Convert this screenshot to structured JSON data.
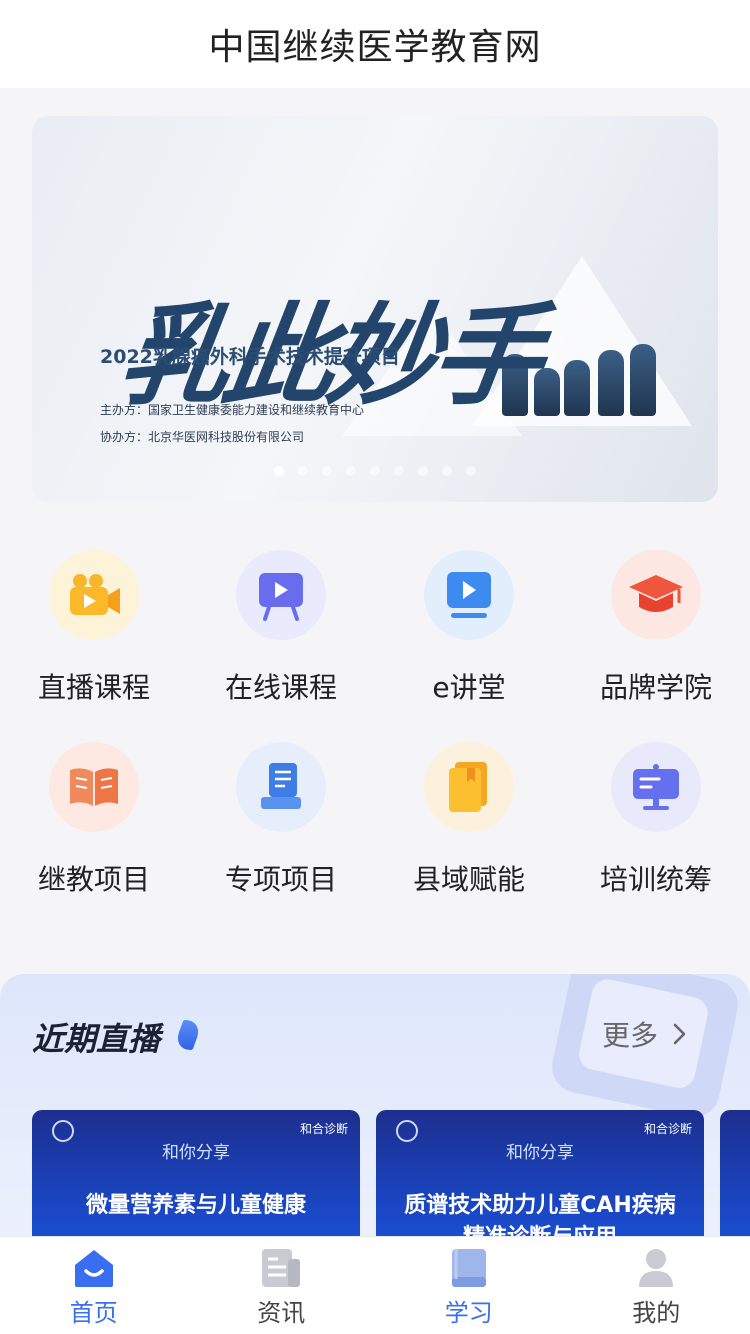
{
  "header": {
    "title": "中国继续医学教育网"
  },
  "banner": {
    "calligraphy": "乳此妙手",
    "subtitle": "2022乳腺癌外科手术技术提升项目",
    "organizer": "主办方：国家卫生健康委能力建设和继续教育中心",
    "co_organizer": "协办方：北京华医网科技股份有限公司",
    "slide_count": 9,
    "active_slide": 1
  },
  "categories": [
    {
      "label": "直播课程",
      "icon": "video-camera-icon"
    },
    {
      "label": "在线课程",
      "icon": "presentation-play-icon"
    },
    {
      "label": "e讲堂",
      "icon": "monitor-play-icon"
    },
    {
      "label": "品牌学院",
      "icon": "graduation-cap-icon"
    },
    {
      "label": "继教项目",
      "icon": "open-book-icon"
    },
    {
      "label": "专项项目",
      "icon": "document-stack-icon"
    },
    {
      "label": "县域赋能",
      "icon": "folder-book-icon"
    },
    {
      "label": "培训统筹",
      "icon": "signboard-icon"
    }
  ],
  "live": {
    "title": "近期直播",
    "more_label": "更多",
    "cards": [
      {
        "brand": "和合诊断",
        "share": "和你分享",
        "title": "微量营养素与儿童健康"
      },
      {
        "brand": "和合诊断",
        "share": "和你分享",
        "title": "质谱技术助力儿童CAH疾病精准诊断与应用"
      }
    ]
  },
  "tabbar": {
    "tabs": [
      {
        "label": "首页",
        "icon": "home-icon",
        "active": true
      },
      {
        "label": "资讯",
        "icon": "news-icon",
        "active": false
      },
      {
        "label": "学习",
        "icon": "book-icon",
        "active": true
      },
      {
        "label": "我的",
        "icon": "user-icon",
        "active": false
      }
    ]
  },
  "colors": {
    "accent": "#3a6ef0",
    "background": "#f5f5f7",
    "card_blue": "#1a48c7"
  }
}
